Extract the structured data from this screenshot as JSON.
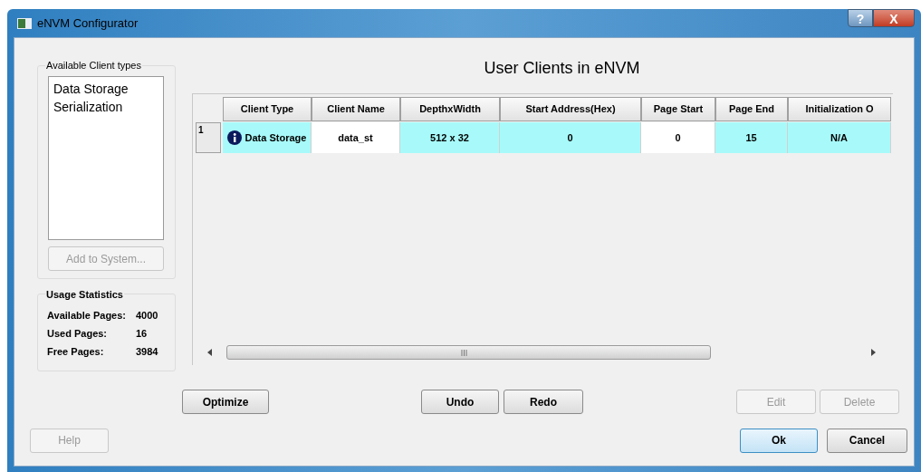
{
  "window": {
    "title": "eNVM Configurator",
    "controls": [
      "?",
      "X"
    ]
  },
  "client_types": {
    "title": "Available Client types",
    "items": [
      "Data Storage",
      "Serialization"
    ],
    "add_button": {
      "label": "Add to System...",
      "disabled": true
    }
  },
  "usage_statistics": {
    "title": "Usage Statistics",
    "rows": [
      {
        "label": "Available Pages:",
        "value": "4000"
      },
      {
        "label": "Used Pages:",
        "value": "16"
      },
      {
        "label": "Free Pages:",
        "value": "3984"
      }
    ]
  },
  "heading": "User Clients in eNVM",
  "table": {
    "columns": [
      "Client Type",
      "Client Name",
      "DepthxWidth",
      "Start Address(Hex)",
      "Page Start",
      "Page End",
      "Initialization O"
    ],
    "rows": [
      {
        "number": "1",
        "cells": [
          {
            "text": "Data Storage",
            "highlighted": true,
            "info": true
          },
          {
            "text": "data_st",
            "highlighted": false
          },
          {
            "text": "512 x 32",
            "highlighted": true
          },
          {
            "text": "0",
            "highlighted": true
          },
          {
            "text": "0",
            "highlighted": false
          },
          {
            "text": "15",
            "highlighted": true
          },
          {
            "text": "N/A",
            "highlighted": true
          }
        ]
      }
    ]
  },
  "action_buttons": [
    {
      "label": "Optimize",
      "disabled": false
    },
    {
      "label": "Undo",
      "disabled": false
    },
    {
      "label": "Redo",
      "disabled": false
    },
    {
      "label": "Edit",
      "disabled": true
    },
    {
      "label": "Delete",
      "disabled": true
    }
  ],
  "footer_buttons": [
    {
      "label": "Help",
      "disabled": true
    },
    {
      "label": "Ok",
      "disabled": false,
      "default": true
    },
    {
      "label": "Cancel",
      "disabled": false
    }
  ]
}
